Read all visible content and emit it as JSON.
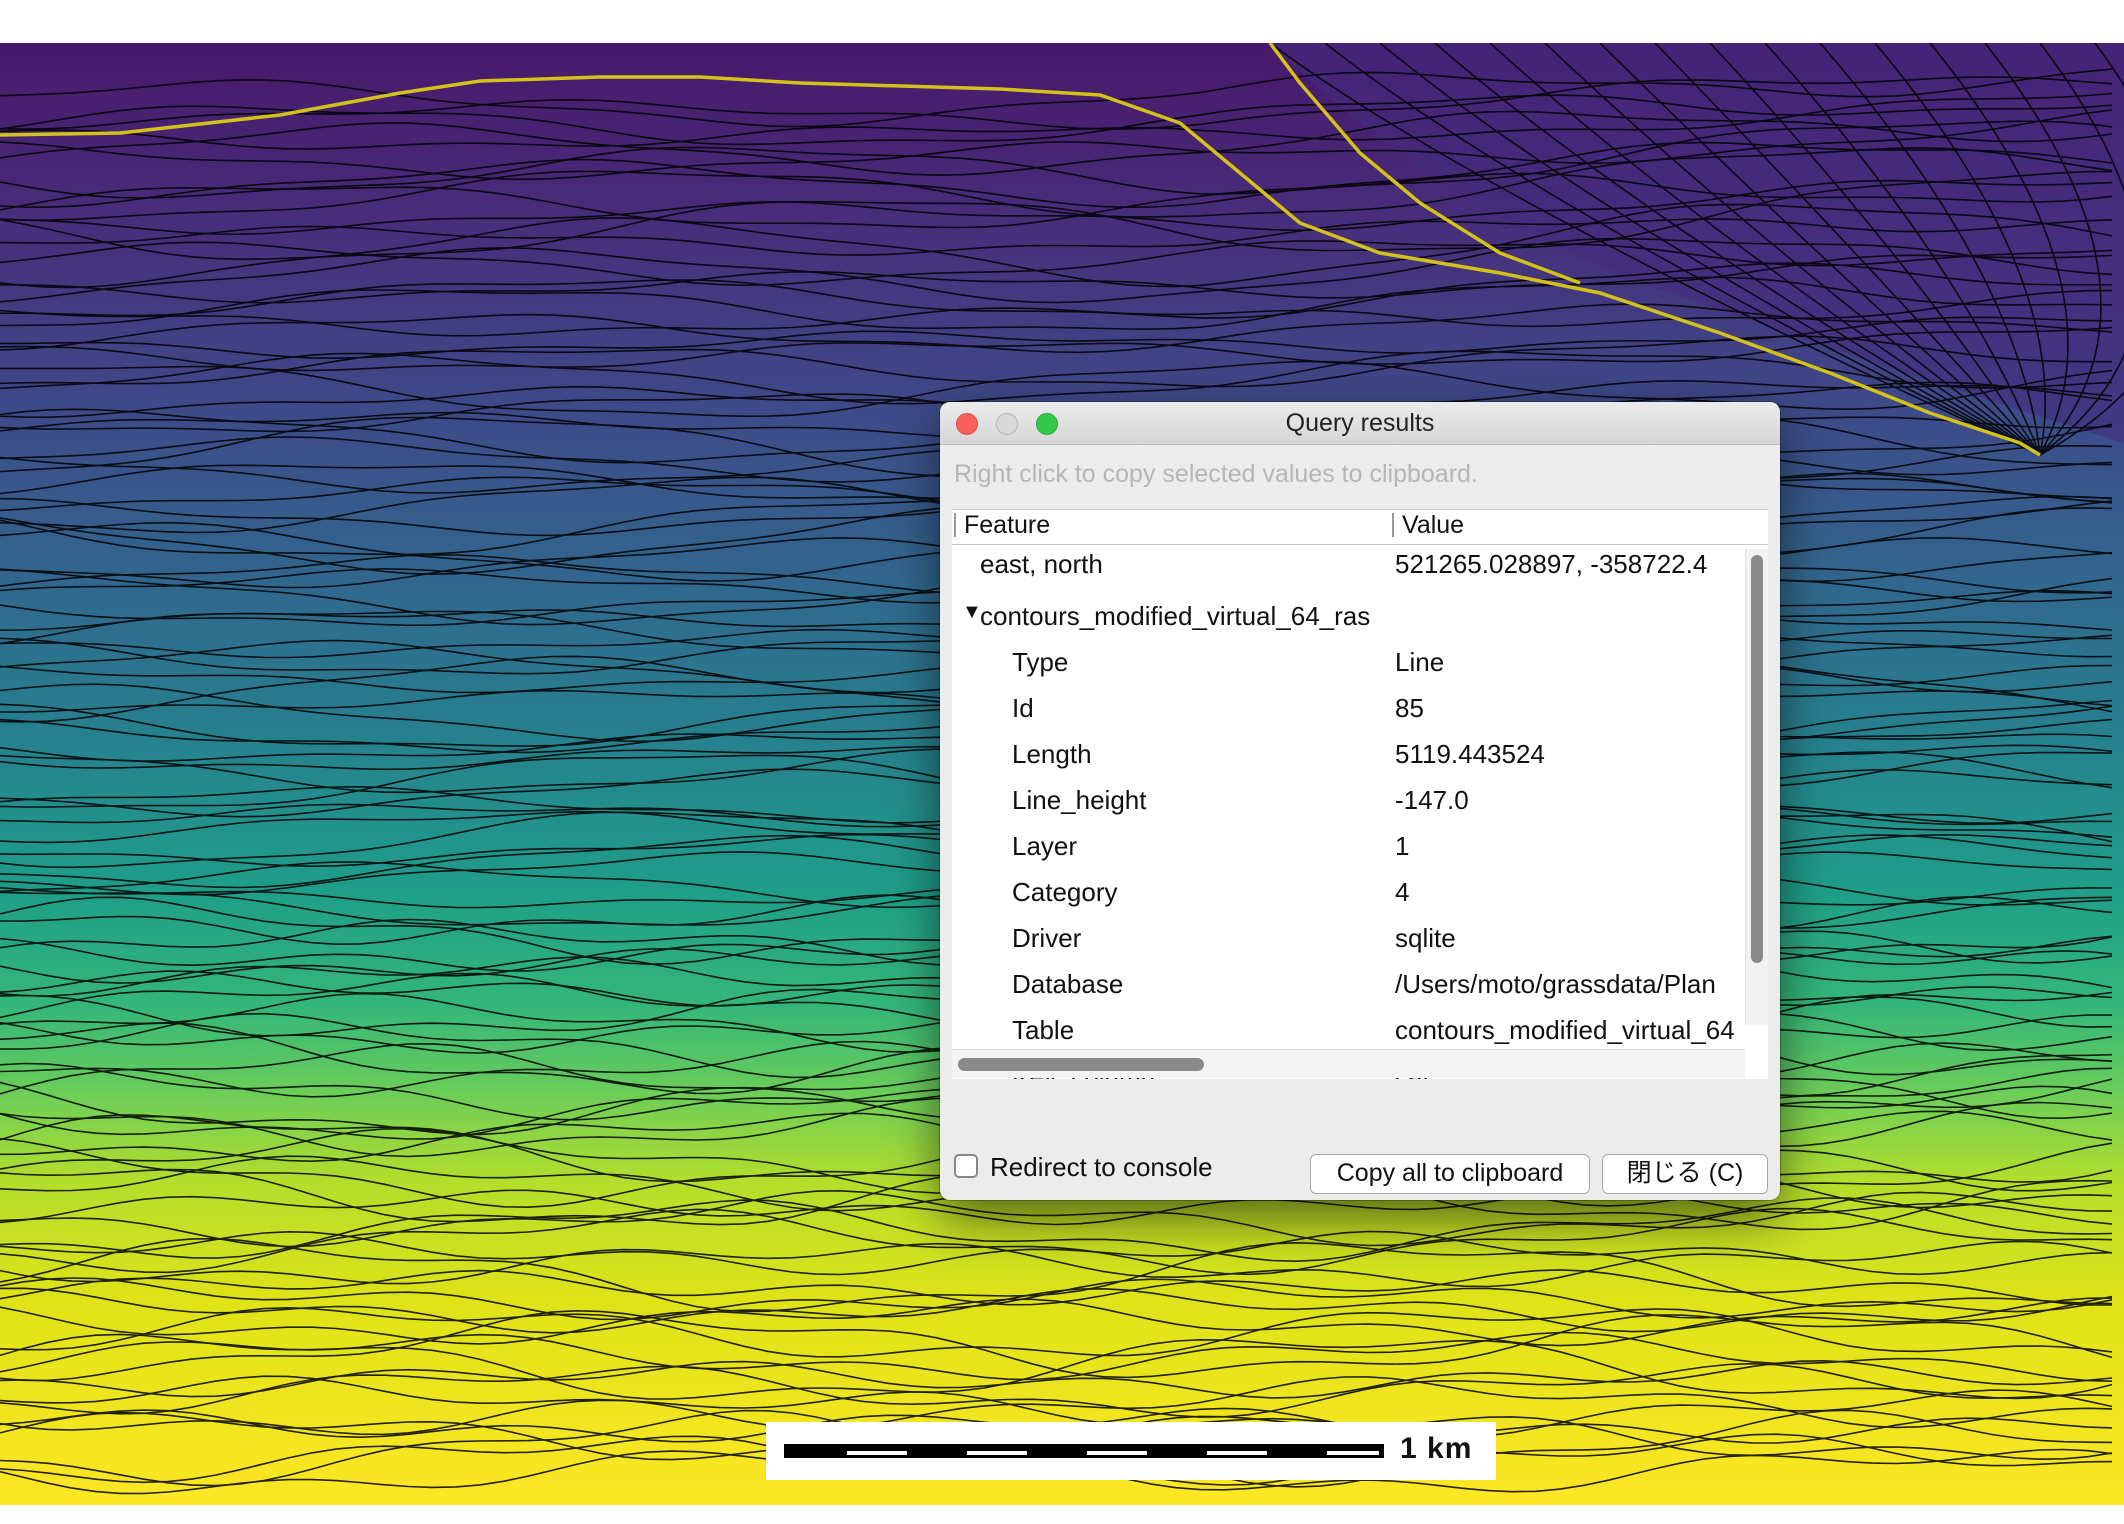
{
  "dialog": {
    "title": "Query results",
    "hint": "Right click to copy selected values to clipboard.",
    "columns": {
      "feature": "Feature",
      "value": "Value"
    },
    "coords": {
      "key": "east, north",
      "value": "521265.028897, -358722.4"
    },
    "layer_name": "contours_modified_virtual_64_ras",
    "attributes": [
      {
        "key": "Type",
        "value": "Line"
      },
      {
        "key": "Id",
        "value": "85"
      },
      {
        "key": "Length",
        "value": "5119.443524"
      },
      {
        "key": "Line_height",
        "value": "-147.0"
      },
      {
        "key": "Layer",
        "value": "1"
      },
      {
        "key": "Category",
        "value": "4"
      },
      {
        "key": "Driver",
        "value": "sqlite"
      },
      {
        "key": "Database",
        "value": "/Users/moto/grassdata/Plan"
      },
      {
        "key": "Table",
        "value": "contours_modified_virtual_64"
      },
      {
        "key": "Key_column",
        "value": "cat"
      }
    ],
    "redirect_label": "Redirect to console",
    "redirect_checked": false,
    "copy_label": "Copy all to clipboard",
    "close_label": "閉じる (C)"
  },
  "scalebar": {
    "label": "1  km"
  },
  "colors": {
    "viridis_top": "#4a1a6e",
    "viridis_mid": "#1f8a8b",
    "viridis_bottom": "#fde725",
    "contour_highlight": "#d4c21a"
  }
}
